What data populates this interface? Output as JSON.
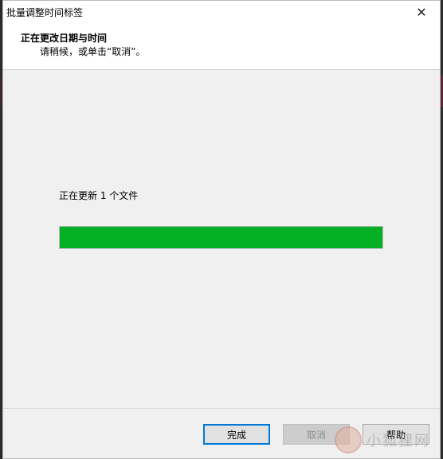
{
  "window": {
    "title": "批量调整时间标签",
    "close_glyph": "✕"
  },
  "header": {
    "title": "正在更改日期与时间",
    "subtitle": "请稍候，或单击“取消”。"
  },
  "main": {
    "status_text": "正在更新 1 个文件",
    "progress_fraction": 1.0,
    "progress_color": "#06b025"
  },
  "footer": {
    "finish_label": "完成",
    "cancel_label": "取消",
    "help_label": "帮助"
  },
  "watermark": {
    "text": "小狐狸网"
  }
}
